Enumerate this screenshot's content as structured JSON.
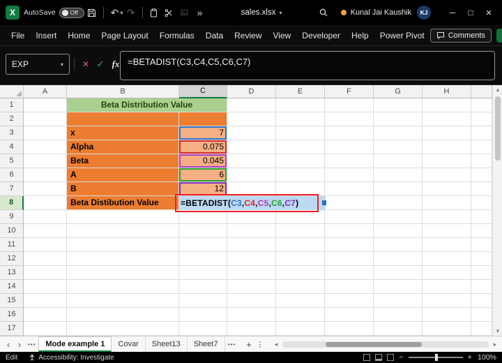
{
  "icons": {
    "caret_down": "▾",
    "chevrons_more": "»",
    "undo": "↶",
    "redo": "↷",
    "cancel": "✕",
    "enter": "✓",
    "fx": "fx",
    "minimize": "─",
    "maximize": "□",
    "close": "×",
    "nav_left": "‹",
    "nav_right": "›",
    "tabs_more": "•••",
    "add_sheet": "+",
    "kebab": "⋮",
    "scroll_left": "◂",
    "scroll_right": "▸",
    "scroll_up": "▲",
    "scroll_down": "▼",
    "zoom_out": "−",
    "zoom_in": "+"
  },
  "titlebar": {
    "app_icon_letter": "X",
    "autosave_label": "AutoSave",
    "autosave_state": "Off",
    "filename": "sales.xlsx",
    "user_name": "Kunal Jai Kaushik",
    "user_initials": "KJ"
  },
  "ribbon": {
    "tabs": [
      "File",
      "Insert",
      "Home",
      "Page Layout",
      "Formulas",
      "Data",
      "Review",
      "View",
      "Developer",
      "Help",
      "Power Pivot"
    ],
    "comments_label": "Comments"
  },
  "formula_bar": {
    "name_box_value": "EXP",
    "formula": "=BETADIST(C3,C4,C5,C6,C7)"
  },
  "grid": {
    "column_headers": [
      "A",
      "B",
      "C",
      "D",
      "E",
      "F",
      "G",
      "H"
    ],
    "row_headers": [
      "1",
      "2",
      "3",
      "4",
      "5",
      "6",
      "7",
      "8",
      "9",
      "10",
      "11",
      "12",
      "13",
      "14",
      "15",
      "16",
      "17"
    ],
    "active_column": "C",
    "active_row": 8,
    "cells": {
      "title": "Beta Distribution Value",
      "rows": [
        {
          "label": "x",
          "value": "7",
          "ref_color": "#2E75C6"
        },
        {
          "label": "Alpha",
          "value": "0.075",
          "ref_color": "#D92B2B"
        },
        {
          "label": "Beta",
          "value": "0.045",
          "ref_color": "#B03FC9"
        },
        {
          "label": "A",
          "value": "6",
          "ref_color": "#2AA12E"
        },
        {
          "label": "B",
          "value": "12",
          "ref_color": "#7B2FBE"
        }
      ],
      "result_label": "Beta Distibution Value",
      "formula_tokens": [
        {
          "text": "=BETADIST(",
          "color": "#000000"
        },
        {
          "text": "C3",
          "color": "#2E75C6"
        },
        {
          "text": ",",
          "color": "#000000"
        },
        {
          "text": "C4",
          "color": "#D92B2B"
        },
        {
          "text": ",",
          "color": "#000000"
        },
        {
          "text": "C5",
          "color": "#B03FC9"
        },
        {
          "text": ",",
          "color": "#000000"
        },
        {
          "text": "C6",
          "color": "#2AA12E"
        },
        {
          "text": ",",
          "color": "#000000"
        },
        {
          "text": "C7",
          "color": "#7B2FBE"
        },
        {
          "text": ")",
          "color": "#000000"
        }
      ]
    }
  },
  "sheet_bar": {
    "tabs": [
      {
        "label": "Mode example 1",
        "active": true
      },
      {
        "label": "Covar",
        "active": false
      },
      {
        "label": "Sheet13",
        "active": false
      },
      {
        "label": "Sheet7",
        "active": false
      }
    ]
  },
  "status_bar": {
    "mode": "Edit",
    "accessibility": "Accessibility: Investigate",
    "zoom": "100%"
  },
  "colors": {
    "accent_green": "#107C41",
    "header_fill_green": "#A9D08E",
    "label_fill_orange": "#ED7D31",
    "value_fill_orange": "#F4B084",
    "edit_selection_blue": "#BDD9F2",
    "annotation_red": "#ED1C24"
  }
}
